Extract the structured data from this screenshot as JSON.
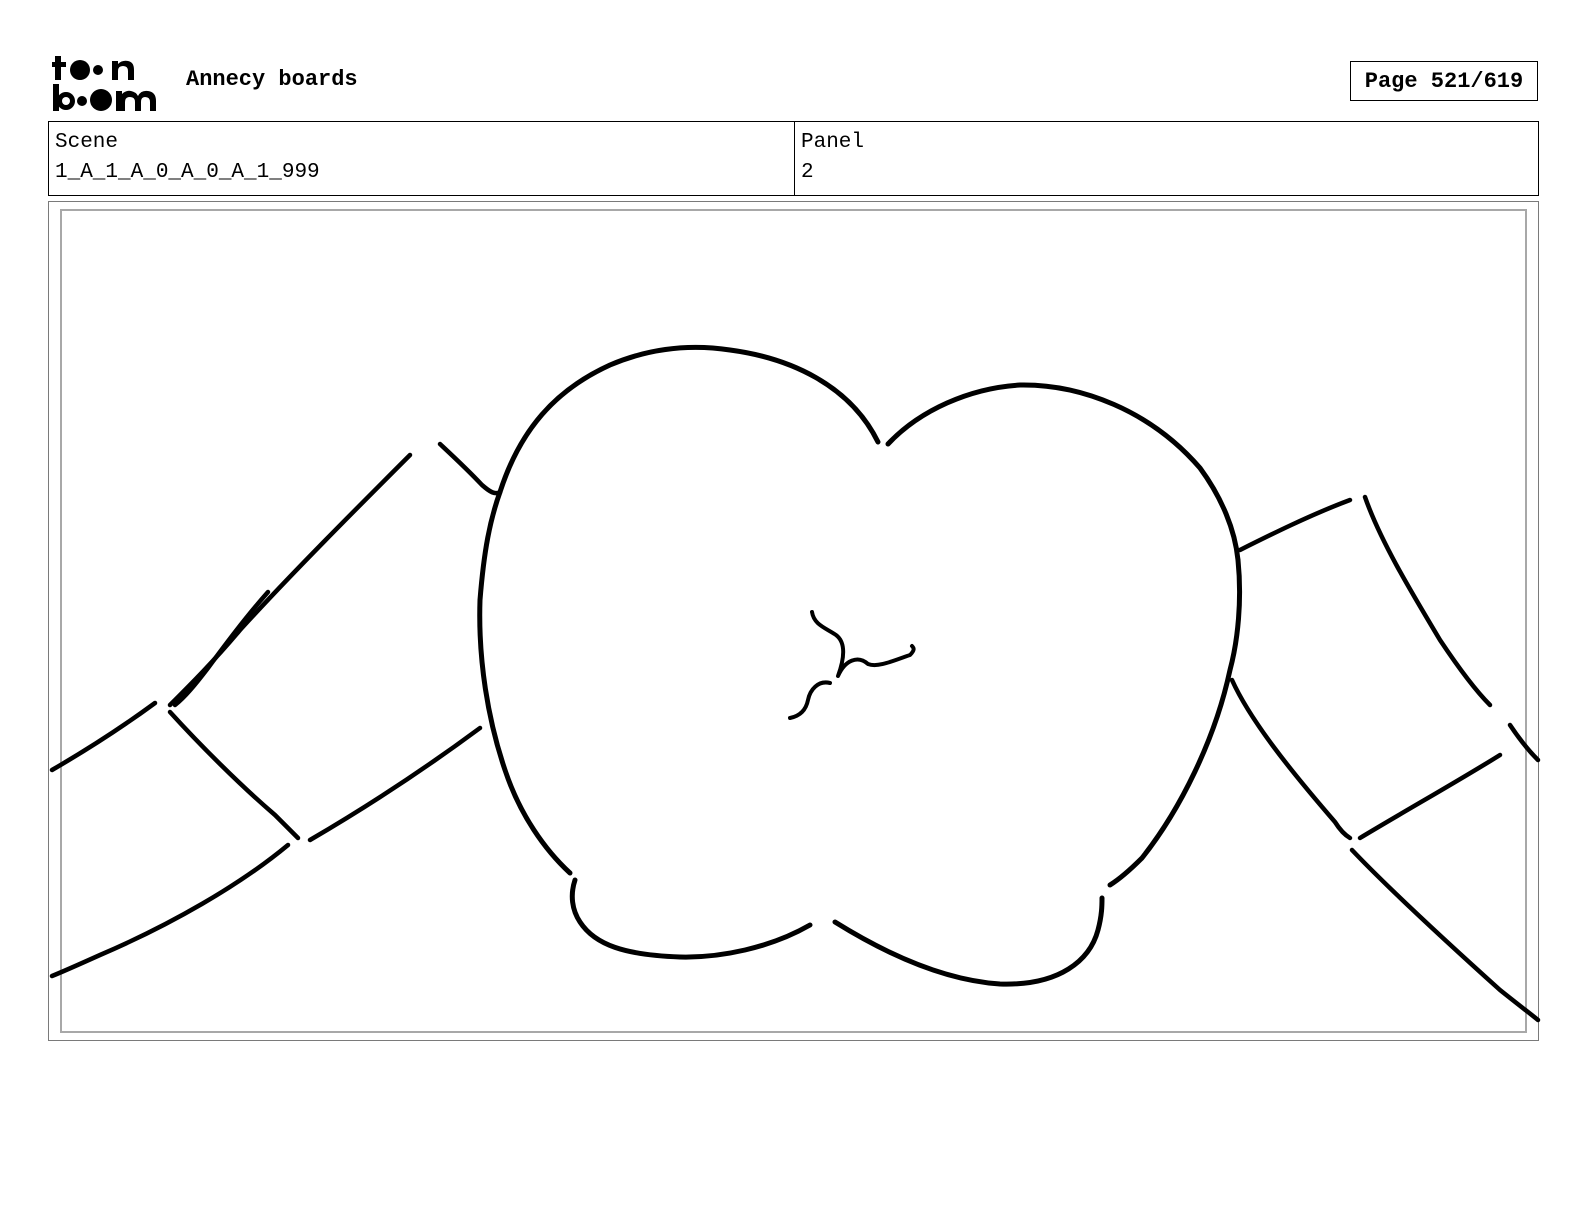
{
  "header": {
    "logo": {
      "icon": "toon-boom-logo",
      "text": "toon boom"
    },
    "project_title": "Annecy boards",
    "page_label": "Page 521/619"
  },
  "info": {
    "scene_label": "Scene",
    "scene_value": "1_A_1_A_0_A_0_A_1_999",
    "panel_label": "Panel",
    "panel_value": "2"
  },
  "panel_image": {
    "icon": "storyboard-sketch-apple"
  }
}
